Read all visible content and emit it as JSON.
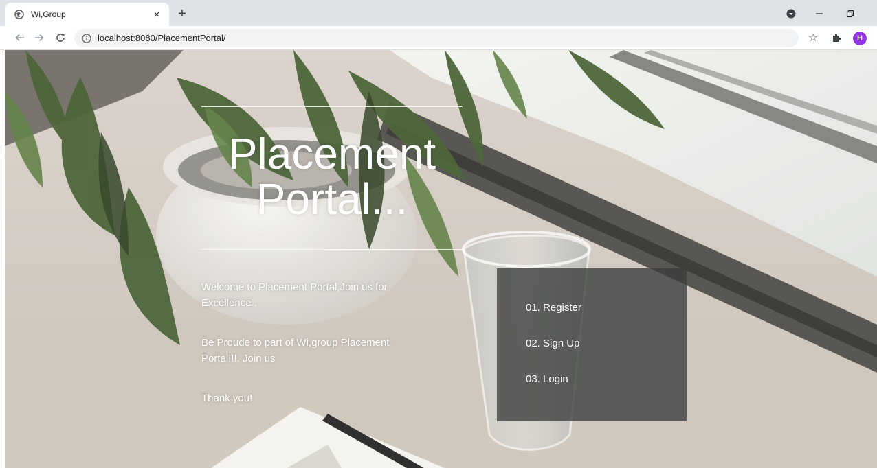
{
  "browser": {
    "tab_title": "Wi,Group",
    "tab_close_glyph": "×",
    "new_tab_glyph": "+",
    "url": "localhost:8080/PlacementPortal/",
    "profile_initial": "H",
    "profile_color": "#9334e6"
  },
  "icons": {
    "favicon": "globe-icon",
    "back": "arrow-left-icon",
    "forward": "arrow-right-icon",
    "reload": "reload-icon",
    "site_info": "info-icon",
    "bookmark": "star-icon",
    "extensions": "puzzle-icon"
  },
  "hero": {
    "title_line1": "Placement",
    "title_line2": "Portal..."
  },
  "intro": {
    "paragraph1": "Welcome to Placement Portal,Join us for Excellence .",
    "paragraph2": "Be Proude to part of Wi,group Placement Portal!!!. Join us",
    "paragraph3": "Thank you!"
  },
  "menu": {
    "items": [
      {
        "label": "01. Register"
      },
      {
        "label": "02. Sign Up"
      },
      {
        "label": "03. Login"
      }
    ]
  }
}
